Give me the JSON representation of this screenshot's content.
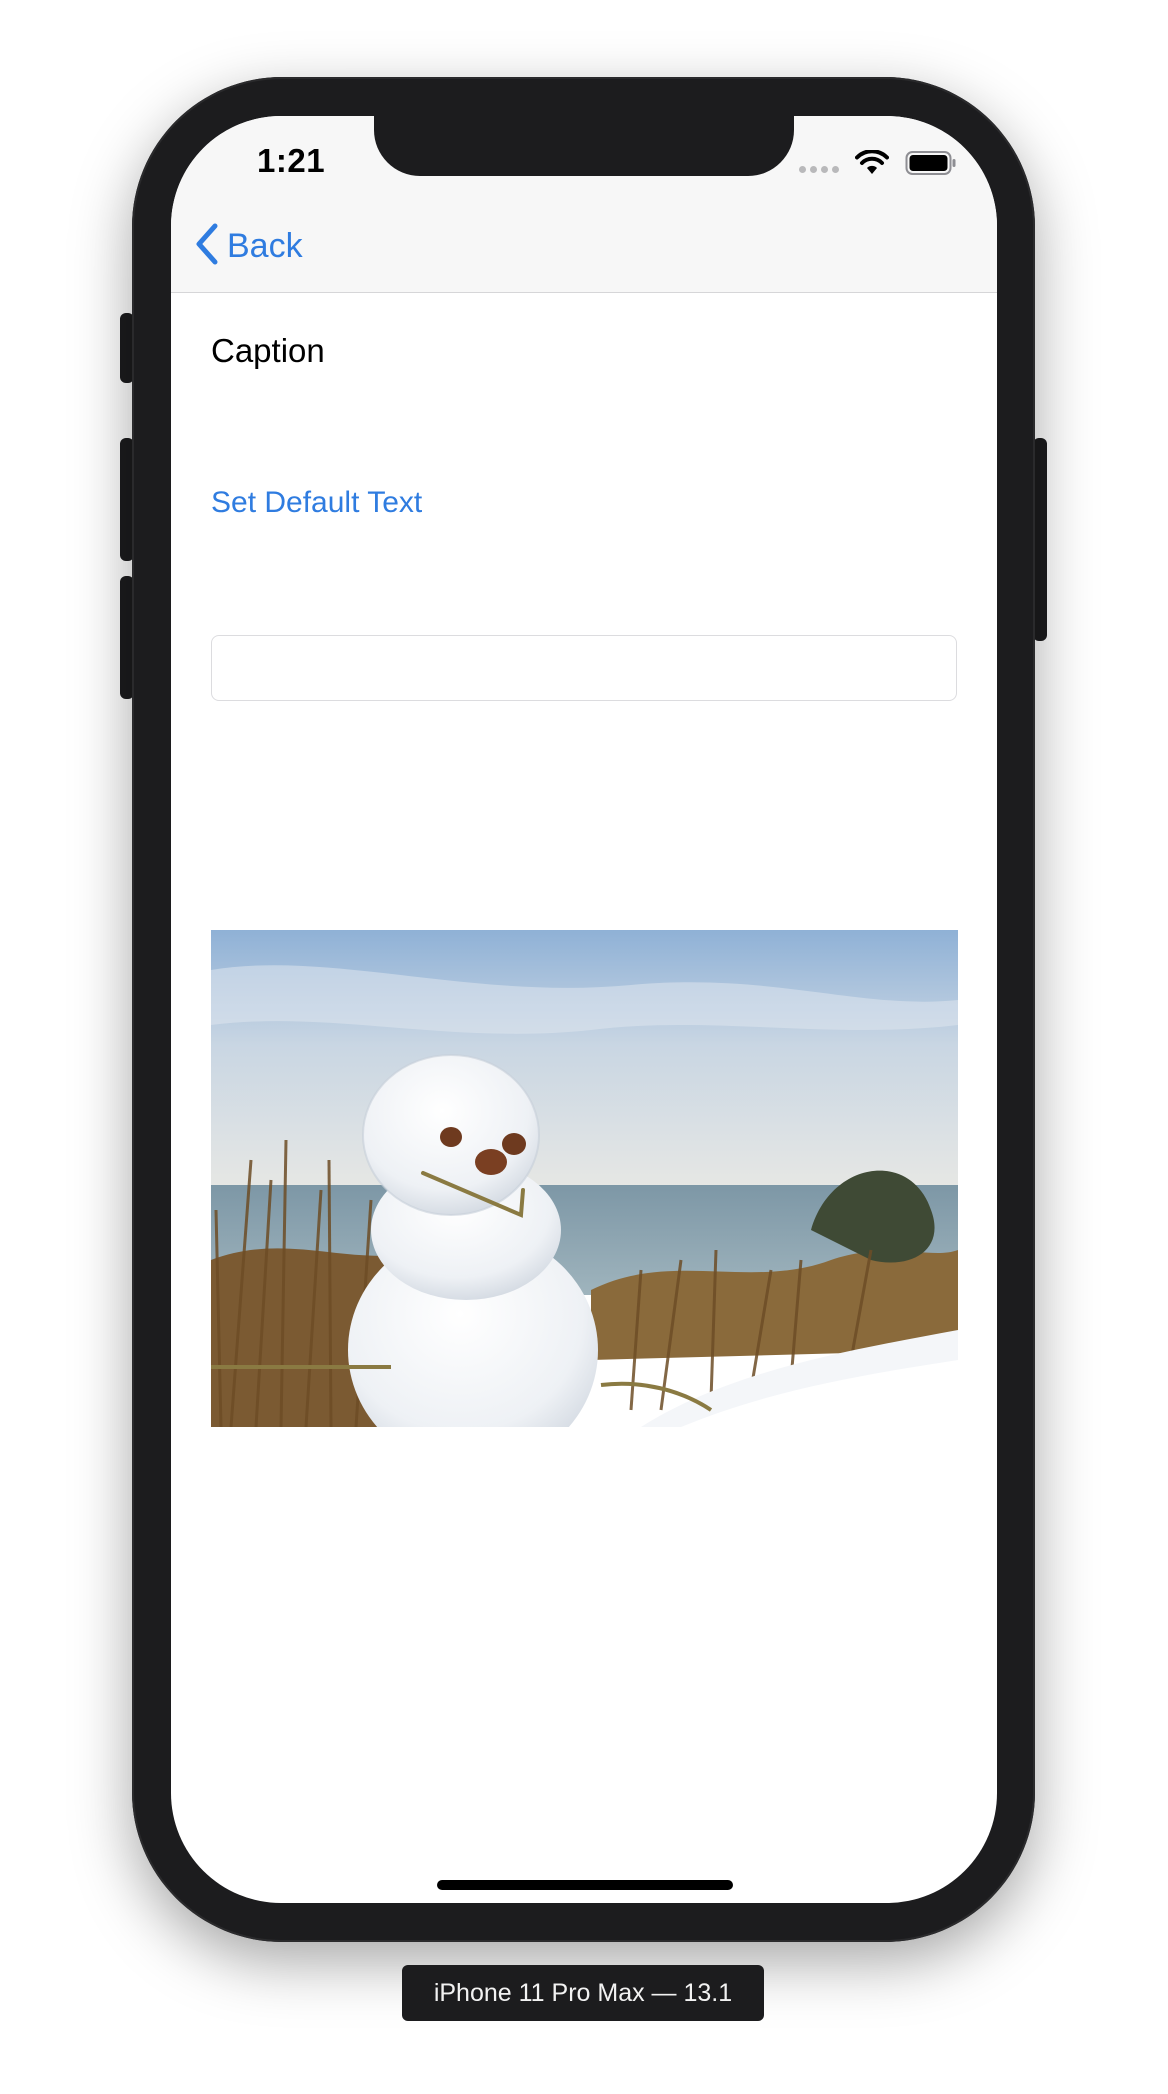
{
  "status_bar": {
    "time": "1:21"
  },
  "nav": {
    "back_label": "Back"
  },
  "content": {
    "caption": "Caption",
    "set_default_text_label": "Set Default Text",
    "text_field_value": "",
    "image_icon": "snowman-photo"
  },
  "simulator": {
    "device_label": "iPhone 11 Pro Max — 13.1"
  },
  "colors": {
    "accent": "#2f7ce0",
    "frame": "#1c1c1e"
  }
}
